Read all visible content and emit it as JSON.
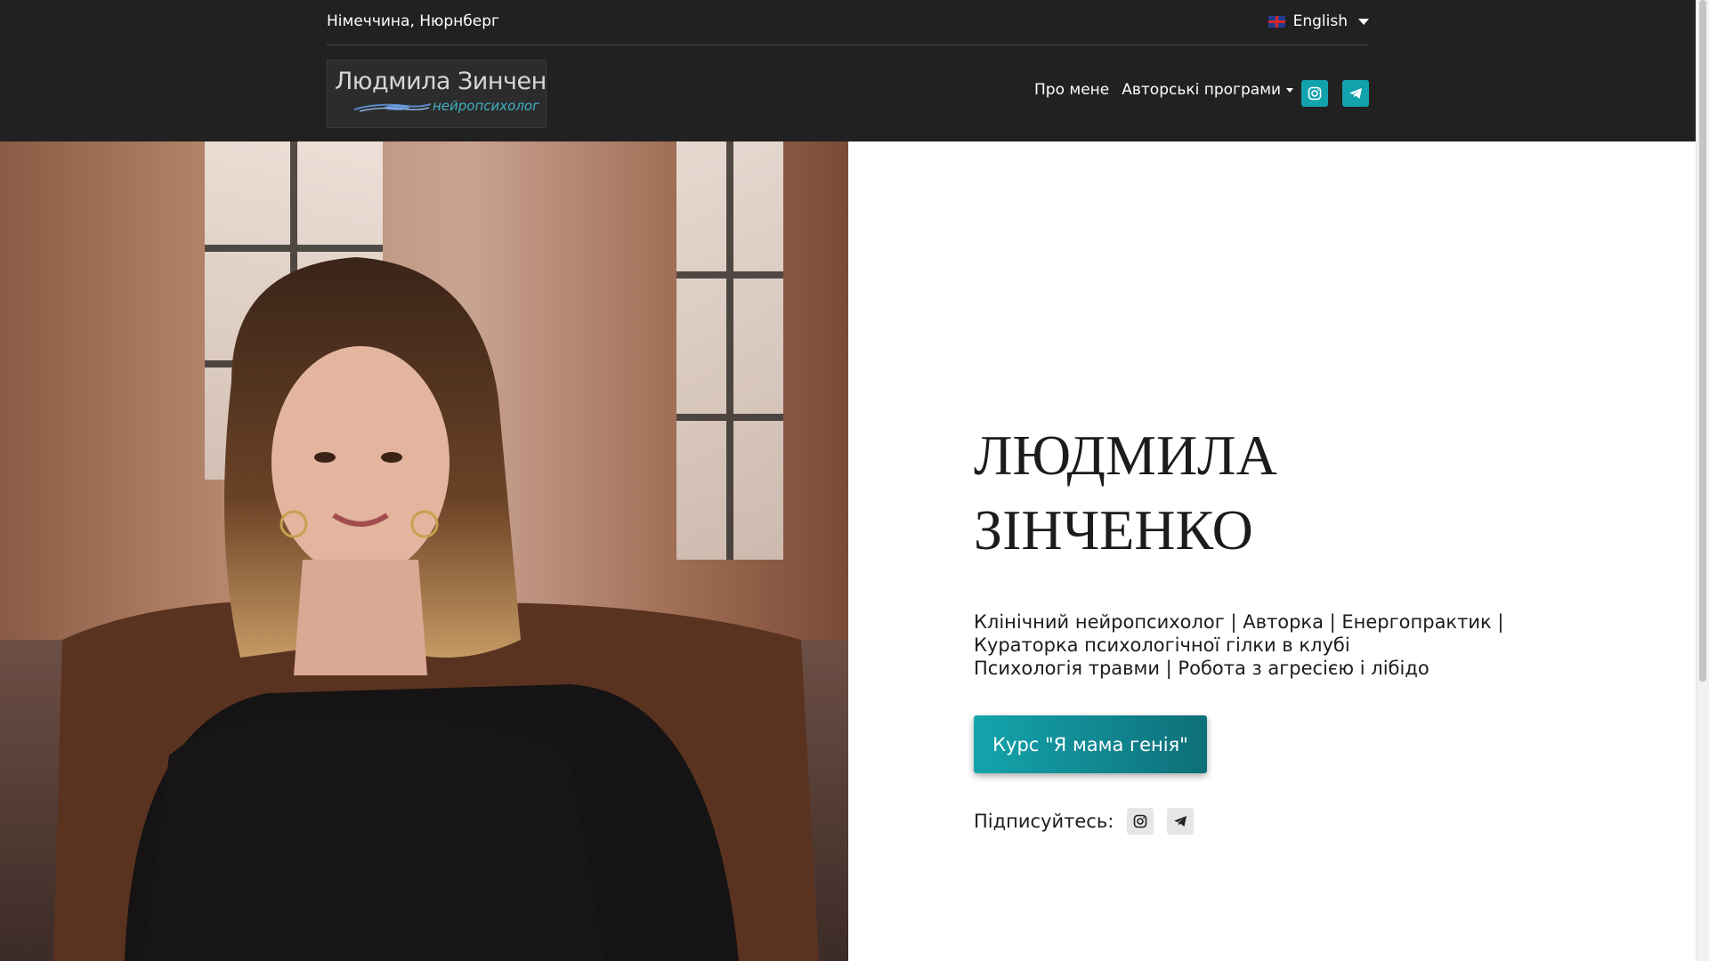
{
  "topbar": {
    "location": "Німеччина, Нюрнберг",
    "language": "English"
  },
  "logo": {
    "title": "Людмила Зинченко",
    "subtitle": "нейропсихолог"
  },
  "nav": {
    "items": [
      {
        "label": "Про мене"
      },
      {
        "label": "Авторські програми"
      }
    ],
    "icons": [
      "instagram-icon",
      "telegram-icon"
    ]
  },
  "hero": {
    "name_line1": "ЛЮДМИЛА",
    "name_line2": "ЗІНЧЕНКО",
    "subtitle_line1": "Клінічний нейропсихолог | Авторка | Енергопрактик |",
    "subtitle_line2": "Кураторка психологічної гілки в клубі",
    "subtitle_line3": "Психологія травми | Робота з агресією і лібідо",
    "cta_label": "Курс \"Я мама генія\"",
    "subscribe_label": "Підписуйтесь:"
  },
  "colors": {
    "header_bg": "#212121",
    "accent": "#12a2ad",
    "cta_gradient_end": "#0e6f78"
  }
}
